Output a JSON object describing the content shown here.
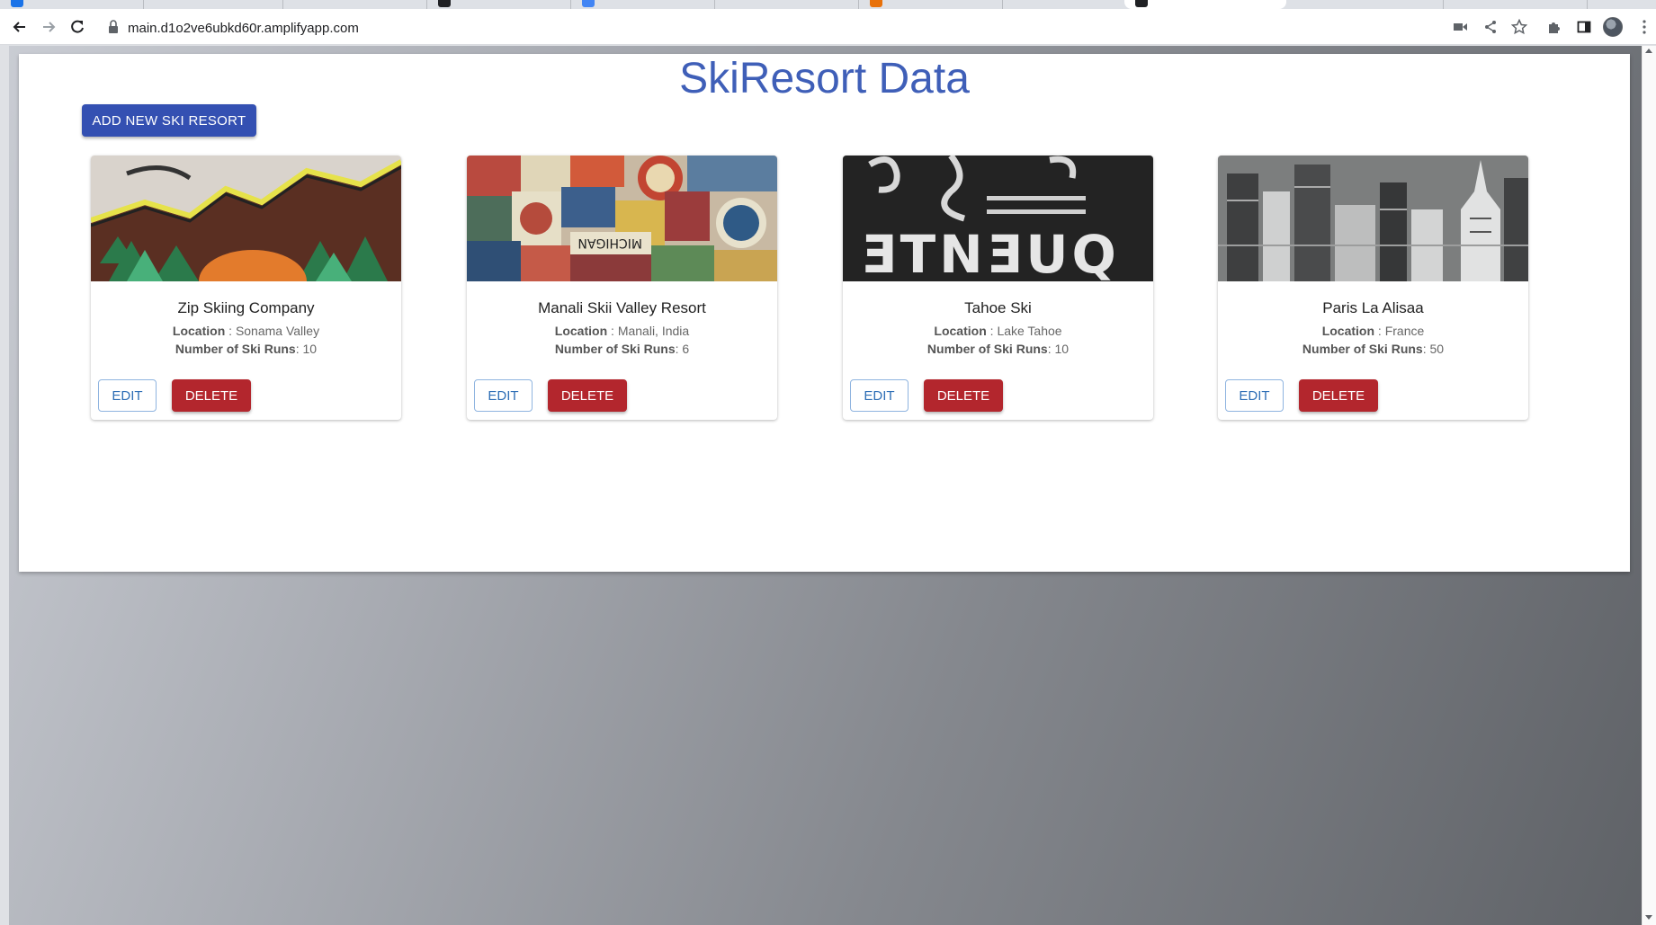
{
  "browser": {
    "url": "main.d1o2ve6ubkd60r.amplifyapp.com"
  },
  "page": {
    "title": "SkiResort Data",
    "add_button_label": "ADD NEW SKI RESORT"
  },
  "labels": {
    "location": "Location",
    "runs": "Number of Ski Runs",
    "edit": "EDIT",
    "delete": "DELETE"
  },
  "resorts": [
    {
      "name": "Zip Skiing Company",
      "location": "Sonama Valley",
      "runs": "10"
    },
    {
      "name": "Manali Skii Valley Resort",
      "location": "Manali, India",
      "runs": "6"
    },
    {
      "name": "Tahoe Ski",
      "location": "Lake Tahoe",
      "runs": "10"
    },
    {
      "name": "Paris La Alisaa",
      "location": "France",
      "runs": "50"
    }
  ],
  "colors": {
    "title": "#3f5fb8",
    "primary_button": "#3450b2",
    "delete_button": "#b3262d",
    "edit_border": "#8fb4e0"
  }
}
